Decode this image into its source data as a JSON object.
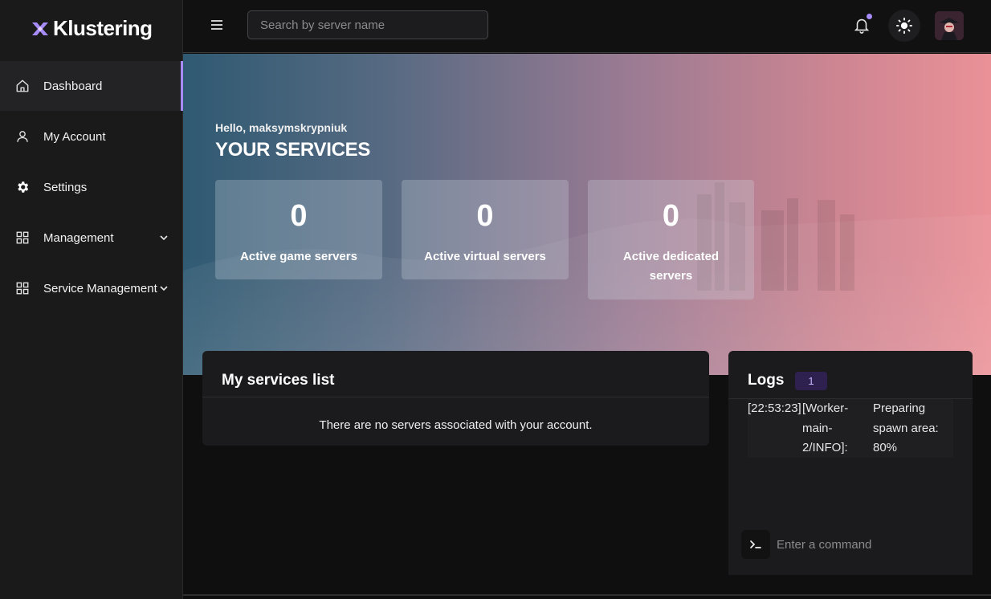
{
  "app": {
    "brand": "Klustering",
    "accent_color": "#a78bfa"
  },
  "sidebar": {
    "items": [
      {
        "label": "Dashboard",
        "icon": "home-icon",
        "active": true
      },
      {
        "label": "My Account",
        "icon": "user-icon"
      },
      {
        "label": "Settings",
        "icon": "gear-icon"
      },
      {
        "label": "Management",
        "icon": "grid-icon",
        "expandable": true
      },
      {
        "label": "Service Management",
        "icon": "grid-icon",
        "expandable": true
      }
    ]
  },
  "topbar": {
    "search_placeholder": "Search by server name",
    "icons": [
      "menu-icon",
      "bell-icon",
      "sun-icon",
      "avatar"
    ]
  },
  "hero": {
    "greeting": "Hello, maksymskrypniuk",
    "title": "YOUR SERVICES",
    "stats": [
      {
        "value": "0",
        "label": "Active game servers"
      },
      {
        "value": "0",
        "label": "Active virtual servers"
      },
      {
        "value": "0",
        "label": "Active dedicated servers"
      }
    ]
  },
  "services": {
    "title": "My services list",
    "empty_message": "There are no servers associated with your account."
  },
  "logs": {
    "title": "Logs",
    "count": "1",
    "entries": [
      {
        "time": "[22:53:23]",
        "source": "[Worker-main-2/INFO]:",
        "message": "Preparing spawn area: 80%"
      }
    ],
    "command_placeholder": "Enter a command"
  }
}
